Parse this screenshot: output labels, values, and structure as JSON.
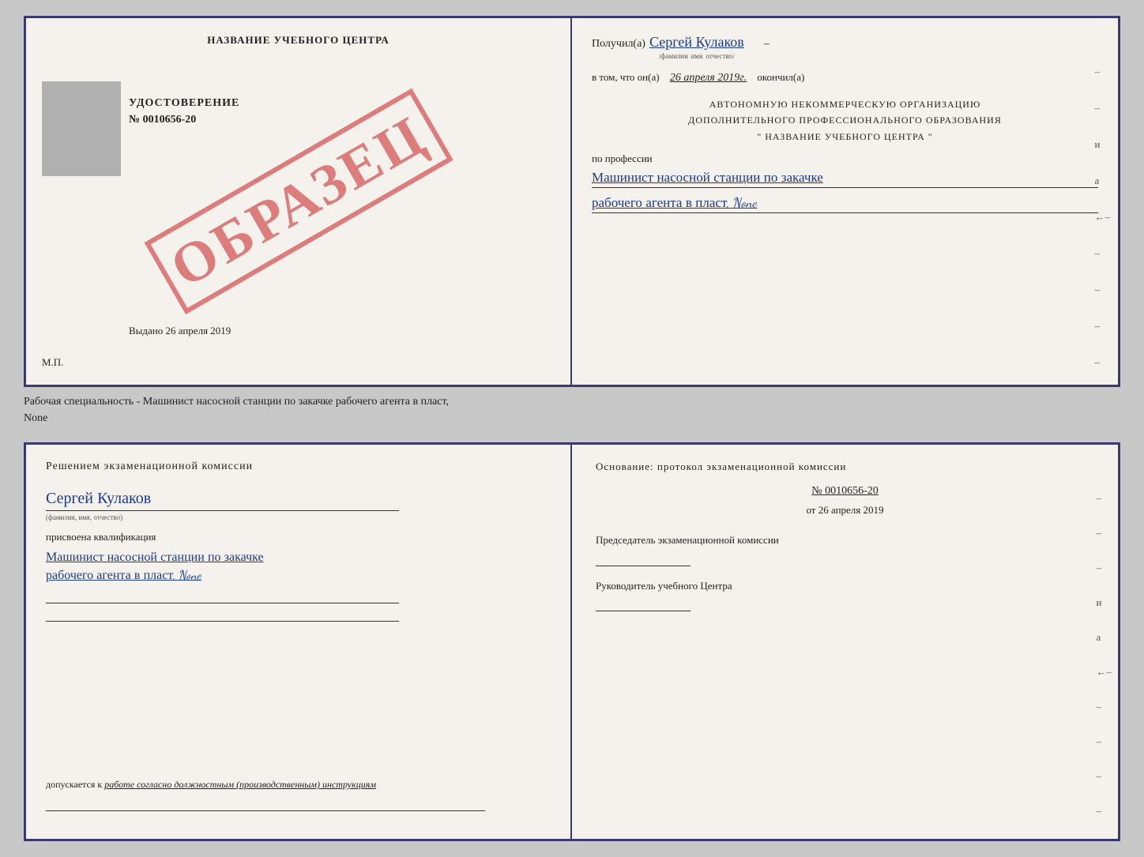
{
  "top_document": {
    "left_panel": {
      "title": "НАЗВАНИЕ УЧЕБНОГО ЦЕНТРА",
      "udostoverenie_label": "УДОСТОВЕРЕНИЕ",
      "number": "№ 0010656-20",
      "vydano_label": "Выдано",
      "vydano_date": "26 апреля 2019",
      "mp_label": "М.П.",
      "obrazets": "ОБРАЗЕЦ"
    },
    "right_panel": {
      "poluchil_label": "Получил(а)",
      "recipient_name": "Сергей Кулаков",
      "recipient_name_sub": "(фамилия, имя, отчество)",
      "vtom_label": "в том, что он(а)",
      "date": "26 апреля 2019г.",
      "okonchil_label": "окончил(а)",
      "org_line1": "АВТОНОМНУЮ НЕКОММЕРЧЕСКУЮ ОРГАНИЗАЦИЮ",
      "org_line2": "ДОПОЛНИТЕЛЬНОГО ПРОФЕССИОНАЛЬНОГО ОБРАЗОВАНИЯ",
      "org_line3": "\"  НАЗВАНИЕ УЧЕБНОГО ЦЕНТРА  \"",
      "po_professii_label": "по профессии",
      "profession_line1": "Машинист насосной станции по закачке",
      "profession_line2": "рабочего агента в пласт, None"
    }
  },
  "middle_text": {
    "line1": "Рабочая специальность - Машинист насосной станции по закачке рабочего агента в пласт,",
    "line2": "None"
  },
  "bottom_document": {
    "left_panel": {
      "resheniem_label": "Решением  экзаменационной  комиссии",
      "name": "Сергей Кулаков",
      "name_sub": "(фамилия, имя, отчество)",
      "prisvoyena_label": "присвоена квалификация",
      "profession_line1": "Машинист насосной станции по закачке",
      "profession_line2": "рабочего агента в пласт, None",
      "dopuskaetsya_label": "допускается к",
      "dopuskaetsya_text": "работе согласно должностным (производственным) инструкциям"
    },
    "right_panel": {
      "osnovanie_label": "Основание:  протокол  экзаменационной  комиссии",
      "protocol_number": "№  0010656-20",
      "protocol_date_prefix": "от",
      "protocol_date": "26 апреля 2019",
      "predsedatel_label": "Председатель экзаменационной комиссии",
      "rukovoditel_label": "Руководитель учебного Центра"
    }
  }
}
